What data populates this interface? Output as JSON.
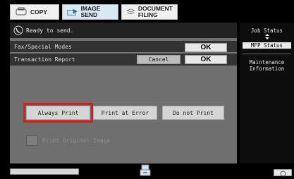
{
  "tabs": [
    {
      "label": "COPY",
      "icon": "copy-icon"
    },
    {
      "label": "IMAGE SEND",
      "icon": "image-send-icon"
    },
    {
      "label": "DOCUMENT\nFILING",
      "icon": "document-filing-icon"
    }
  ],
  "status": {
    "message": "Ready to send.",
    "icon": "phone-icon"
  },
  "fax_modes": {
    "label": "Fax/Special Modes",
    "ok_label": "OK"
  },
  "transaction_report": {
    "label": "Transaction Report",
    "cancel_label": "Cancel",
    "ok_label": "OK"
  },
  "options": {
    "always_print": "Always Print",
    "print_at_error": "Print at Error",
    "do_not_print": "Do not Print",
    "selected": "Always Print"
  },
  "print_original_image": {
    "label": "Print Original Image",
    "checked": false,
    "enabled": false
  },
  "side": {
    "job_status": "Job Status",
    "mfp_status": "MFP Status",
    "maintenance": "Maintenance\nInformation"
  },
  "bottom": {
    "progress": 0,
    "device_icon": "printer-icon",
    "info_icon": "info-icon"
  },
  "colors": {
    "selection_highlight": "#e41b13",
    "panel_gray": "#6f6f6f"
  }
}
